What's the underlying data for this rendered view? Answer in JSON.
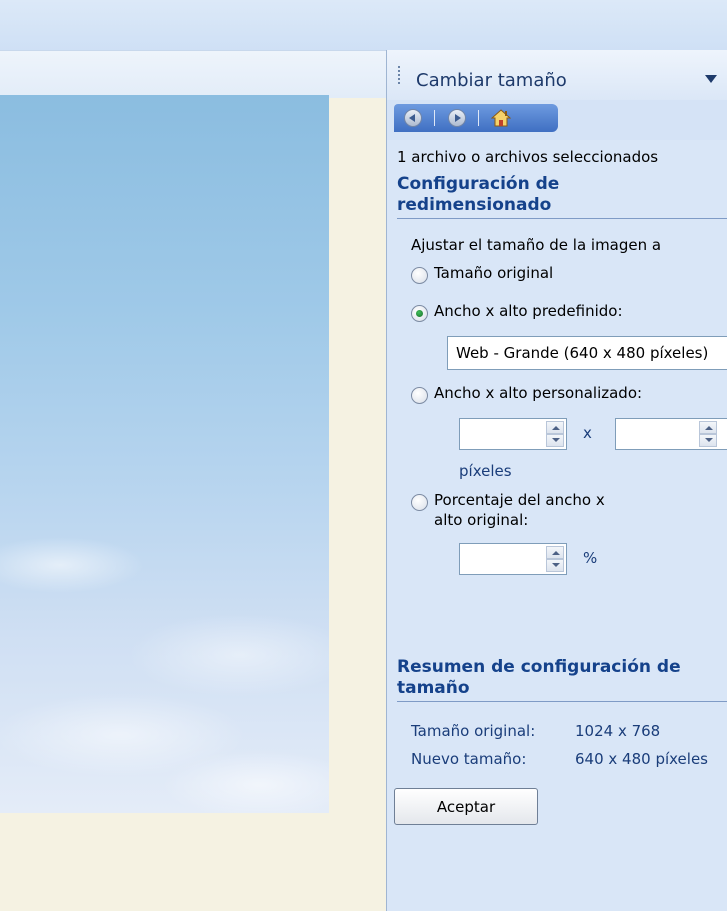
{
  "panel": {
    "title": "Cambiar tamaño",
    "selection_count": "1 archivo o archivos seleccionados",
    "nav_icons": [
      "back-arrow-icon",
      "forward-arrow-icon",
      "home-icon"
    ]
  },
  "resize_settings": {
    "heading": "Configuración de redimensionado",
    "intro": "Ajustar el tamaño de la imagen a",
    "option_original": "Tamaño original",
    "option_predefined": "Ancho x alto predefinido:",
    "predefined_value": "Web - Grande (640 x 480 píxeles)",
    "option_custom": "Ancho x alto personalizado:",
    "custom_width": "",
    "custom_x": "x",
    "custom_height": "",
    "pixels_label": "píxeles",
    "option_percentage": "Porcentaje del ancho x alto original:",
    "percentage_value": "",
    "percent_sign": "%",
    "selected_option": "predefined"
  },
  "summary": {
    "heading": "Resumen de configuración de tamaño",
    "original_label": "Tamaño original:",
    "original_value": "1024 x 768",
    "new_label": "Nuevo tamaño:",
    "new_value": "640 x 480 píxeles"
  },
  "buttons": {
    "accept": "Aceptar"
  },
  "colors": {
    "panel_bg": "#d9e6f7",
    "heading": "#15428b",
    "nav_bar": "#4a7acb",
    "canvas_bg": "#f5f2e2"
  }
}
